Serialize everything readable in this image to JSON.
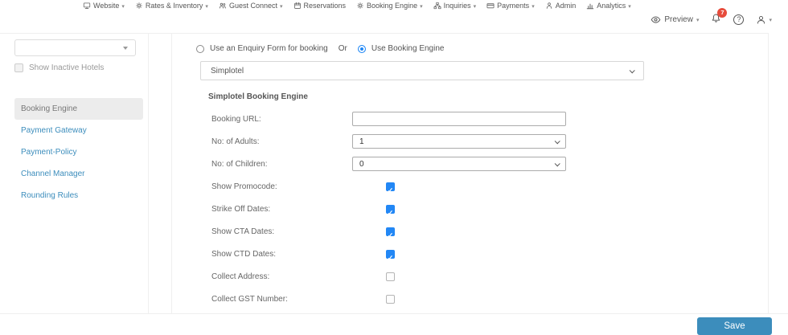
{
  "nav": {
    "items": [
      {
        "label": "Website",
        "icon": "monitor-icon",
        "caret": true
      },
      {
        "label": "Rates & Inventory",
        "icon": "gear-icon",
        "caret": true
      },
      {
        "label": "Guest Connect",
        "icon": "people-icon",
        "caret": true
      },
      {
        "label": "Reservations",
        "icon": "calendar-icon",
        "caret": false
      },
      {
        "label": "Booking Engine",
        "icon": "gear-icon",
        "caret": true
      },
      {
        "label": "Inquiries",
        "icon": "sitemap-icon",
        "caret": true
      },
      {
        "label": "Payments",
        "icon": "card-icon",
        "caret": true
      },
      {
        "label": "Admin",
        "icon": "person-icon",
        "caret": false
      },
      {
        "label": "Analytics",
        "icon": "chart-icon",
        "caret": true
      }
    ]
  },
  "header": {
    "preview_label": "Preview",
    "notification_count": "7"
  },
  "sidebar": {
    "hotel_select_value": "",
    "show_inactive_label": "Show Inactive Hotels",
    "show_inactive_checked": false,
    "items": [
      {
        "label": "Booking Engine",
        "active": true
      },
      {
        "label": "Payment Gateway",
        "active": false
      },
      {
        "label": "Payment-Policy",
        "active": false
      },
      {
        "label": "Channel Manager",
        "active": false
      },
      {
        "label": "Rounding Rules",
        "active": false
      }
    ]
  },
  "main": {
    "radio_enquiry_label": "Use an Enquiry Form for booking",
    "radio_enquiry_selected": false,
    "radio_or_label": "Or",
    "radio_engine_label": "Use Booking Engine",
    "radio_engine_selected": true,
    "engine_select_value": "Simplotel",
    "section_title": "Simplotel Booking Engine",
    "fields": [
      {
        "label": "Booking URL:",
        "type": "text",
        "value": ""
      },
      {
        "label": "No: of Adults:",
        "type": "select",
        "value": "1"
      },
      {
        "label": "No: of Children:",
        "type": "select",
        "value": "0"
      },
      {
        "label": "Show Promocode:",
        "type": "checkbox",
        "checked": true
      },
      {
        "label": "Strike Off Dates:",
        "type": "checkbox",
        "checked": true
      },
      {
        "label": "Show CTA Dates:",
        "type": "checkbox",
        "checked": true
      },
      {
        "label": "Show CTD Dates:",
        "type": "checkbox",
        "checked": true
      },
      {
        "label": "Collect Address:",
        "type": "checkbox",
        "checked": false
      },
      {
        "label": "Collect GST Number:",
        "type": "checkbox",
        "checked": false
      }
    ]
  },
  "footer": {
    "save_label": "Save"
  },
  "colors": {
    "accent_blue": "#3c8dbc",
    "checkbox_blue": "#2287f5",
    "badge_red": "#e74c3c",
    "divider": "#efefef",
    "text_gray": "#666666"
  }
}
